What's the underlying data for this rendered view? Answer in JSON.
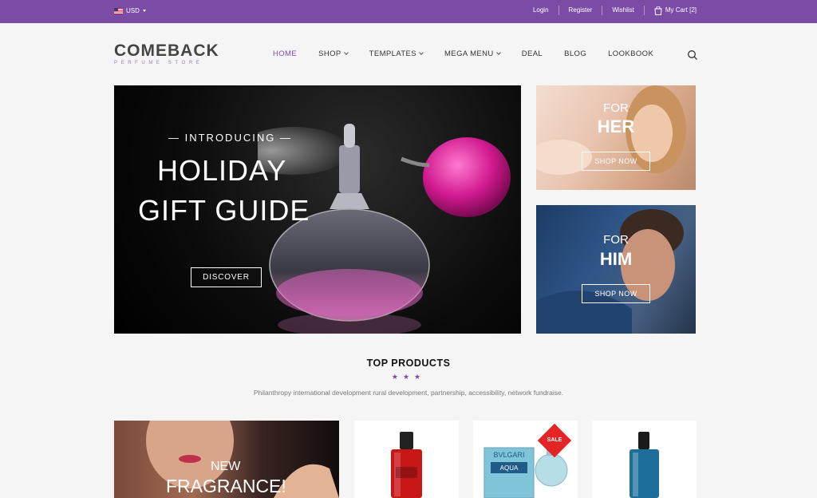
{
  "topbar": {
    "currency": "USD",
    "links": [
      "Login",
      "Register",
      "Wishlist"
    ],
    "cart_label": "My Cart [2]"
  },
  "brand": {
    "name": "COMEBACK",
    "tagline": "PERFUME STORE"
  },
  "nav": {
    "items": [
      {
        "label": "HOME",
        "active": true,
        "dropdown": false
      },
      {
        "label": "SHOP",
        "dropdown": true
      },
      {
        "label": "TEMPLATES",
        "dropdown": true
      },
      {
        "label": "MEGA MENU",
        "dropdown": true
      },
      {
        "label": "DEAL",
        "dropdown": false
      },
      {
        "label": "BLOG",
        "dropdown": false
      },
      {
        "label": "LOOKBOOK",
        "dropdown": false
      }
    ]
  },
  "hero": {
    "intro": "— INTRODUCING —",
    "title_line1": "HOLIDAY",
    "title_line2": "GIFT GUIDE",
    "button": "DISCOVER"
  },
  "banners": {
    "her": {
      "for": "FOR",
      "big": "HER",
      "button": "SHOP NOW"
    },
    "him": {
      "for": "FOR",
      "big": "HIM",
      "button": "SHOP NOW"
    }
  },
  "products_section": {
    "title": "TOP PRODUCTS",
    "stars": "★★★",
    "description": "Philanthropy international development rural development, partnership, accessibility, network fundraise."
  },
  "promo": {
    "new": "NEW",
    "fragrance": "FRAGRANCE!"
  },
  "product_cards": [
    {
      "icon": "red-perfume-bottle-icon"
    },
    {
      "icon": "bvlgari-aqua-box-icon",
      "badge": "SALE",
      "box_brand": "BVLGARI",
      "box_name": "AQUA"
    },
    {
      "icon": "blue-perfume-bottle-icon"
    }
  ],
  "colors": {
    "accent": "#7b4ca6",
    "sale": "#e32525"
  }
}
